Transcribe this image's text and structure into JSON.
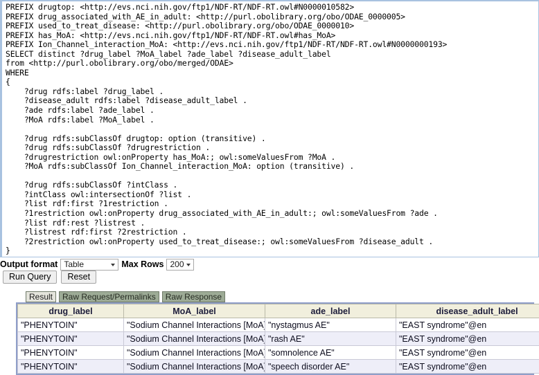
{
  "editor": {
    "query": "PREFIX drugtop: <http://evs.nci.nih.gov/ftp1/NDF-RT/NDF-RT.owl#N0000010582>\nPREFIX drug_associated_with_AE_in_adult: <http://purl.obolibrary.org/obo/ODAE_0000005>\nPREFIX used_to_treat_disease: <http://purl.obolibrary.org/obo/ODAE_0000010>\nPREFIX has_MoA: <http://evs.nci.nih.gov/ftp1/NDF-RT/NDF-RT.owl#has_MoA>\nPREFIX Ion_Channel_interaction_MoA: <http://evs.nci.nih.gov/ftp1/NDF-RT/NDF-RT.owl#N0000000193>\nSELECT distinct ?drug_label ?MoA_label ?ade_label ?disease_adult_label\nfrom <http://purl.obolibrary.org/obo/merged/ODAE>\nWHERE\n{\n    ?drug rdfs:label ?drug_label .\n    ?disease_adult rdfs:label ?disease_adult_label .\n    ?ade rdfs:label ?ade_label .\n    ?MoA rdfs:label ?MoA_label .\n\n    ?drug rdfs:subClassOf drugtop: option (transitive) .\n    ?drug rdfs:subClassOf ?drugrestriction .\n    ?drugrestriction owl:onProperty has_MoA:; owl:someValuesFrom ?MoA .\n    ?MoA rdfs:subClassOf Ion_Channel_interaction_MoA: option (transitive) .\n\n    ?drug rdfs:subClassOf ?intClass .\n    ?intClass owl:intersectionOf ?list .\n    ?list rdf:first ?1restriction .\n    ?1restriction owl:onProperty drug_associated_with_AE_in_adult:; owl:someValuesFrom ?ade .\n    ?list rdf:rest ?listrest .\n    ?listrest rdf:first ?2restriction .\n    ?2restriction owl:onProperty used_to_treat_disease:; owl:someValuesFrom ?disease_adult .\n}"
  },
  "controls": {
    "output_format_label": "Output format",
    "output_format_value": "Table",
    "max_rows_label": "Max Rows",
    "max_rows_value": "200",
    "run_query_label": "Run Query",
    "reset_label": "Reset"
  },
  "tabs": [
    {
      "label": "Result",
      "active": true
    },
    {
      "label": "Raw Request/Permalinks",
      "active": false
    },
    {
      "label": "Raw Response",
      "active": false
    }
  ],
  "results": {
    "columns": [
      "drug_label",
      "MoA_label",
      "ade_label",
      "disease_adult_label"
    ],
    "rows": [
      [
        "\"PHENYTOIN\"",
        "\"Sodium Channel Interactions [MoA]\"",
        "\"nystagmus AE\"",
        "\"EAST syndrome\"@en"
      ],
      [
        "\"PHENYTOIN\"",
        "\"Sodium Channel Interactions [MoA]\"",
        "\"rash AE\"",
        "\"EAST syndrome\"@en"
      ],
      [
        "\"PHENYTOIN\"",
        "\"Sodium Channel Interactions [MoA]\"",
        "\"somnolence AE\"",
        "\"EAST syndrome\"@en"
      ],
      [
        "\"PHENYTOIN\"",
        "\"Sodium Channel Interactions [MoA]\"",
        "\"speech disorder AE\"",
        "\"EAST syndrome\"@en"
      ]
    ]
  },
  "colors": {
    "editor_border": "#a8c2e0",
    "table_border": "#8f9ec9",
    "header_bg": "#f1efdd",
    "row_alt_bg": "#eeeef8",
    "tab_inactive_bg": "#9dab96",
    "tab_active_bg": "#e4e4dc"
  }
}
